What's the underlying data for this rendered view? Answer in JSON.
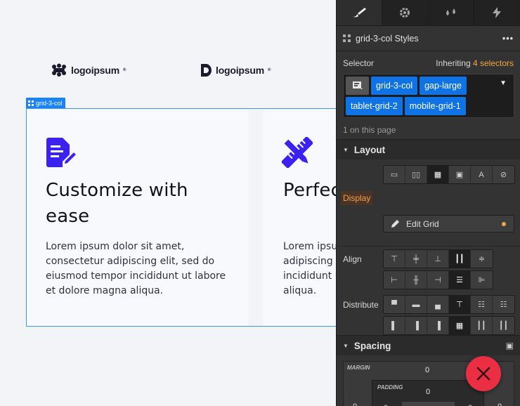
{
  "canvas": {
    "logos": [
      {
        "text": "logoipsum",
        "mark": "®"
      },
      {
        "text": "logoipsum",
        "mark": "®"
      }
    ],
    "grid_tag": "grid-3-col",
    "cards": [
      {
        "icon": "edit-document-icon",
        "title": "Customize with ease",
        "body": "Lorem ipsum dolor sit amet, consectetur adipiscing elit, sed do eiusmod tempor incididunt ut labore et dolore magna aliqua."
      },
      {
        "icon": "design-tools-icon",
        "title": "Perfectly Responsive",
        "body": "Lorem ipsum dolor sit amet, consectetur adipiscing elit, sed do eiusmod tempor incididunt ut labore et dolore magna aliqua."
      }
    ]
  },
  "panel": {
    "tabs": [
      {
        "icon": "brush-icon",
        "active": true
      },
      {
        "icon": "gear-icon",
        "active": false
      },
      {
        "icon": "drops-icon",
        "active": false
      },
      {
        "icon": "lightning-icon",
        "active": false
      }
    ],
    "styles_title": "grid-3-col Styles",
    "selector_label": "Selector",
    "inheriting_prefix": "Inheriting",
    "inheriting_count": "4 selectors",
    "chips": [
      "grid-3-col",
      "gap-large",
      "tablet-grid-2",
      "mobile-grid-1"
    ],
    "on_page": "1 on this page",
    "layout_title": "Layout",
    "display_label": "Display",
    "edit_grid_label": "Edit Grid",
    "align_label": "Align",
    "distribute_label": "Distribute",
    "spacing_title": "Spacing",
    "margin_label": "MARGIN",
    "padding_label": "PADDING",
    "values": {
      "margin_top": "0",
      "padding_top": "0",
      "margin_left": "0",
      "padding_left": "0",
      "padding_right": "0",
      "margin_right": "0"
    }
  },
  "colors": {
    "accent": "#0f73e6",
    "warning": "#f5a73e",
    "close": "#ea2f45",
    "brand_icon": "#3b22f0"
  }
}
